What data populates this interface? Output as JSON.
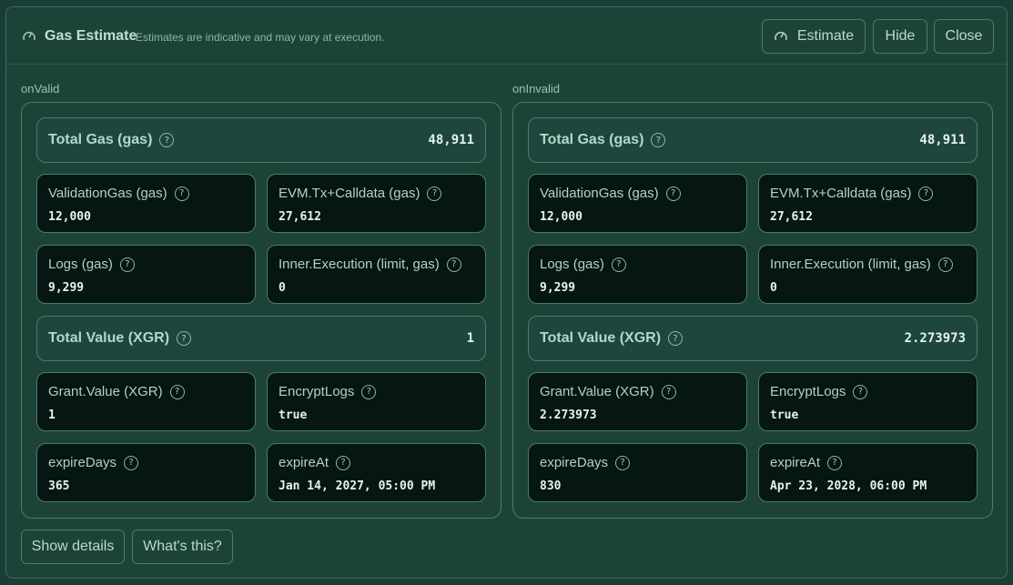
{
  "header": {
    "title": "Gas Estimate",
    "subtitle": "Estimates are indicative and may vary at execution.",
    "estimate_label": "Estimate",
    "hide_label": "Hide",
    "close_label": "Close"
  },
  "help_glyph": "?",
  "valid": {
    "label": "onValid",
    "total_gas": {
      "label": "Total Gas (gas)",
      "value": "48,911"
    },
    "validation_gas": {
      "label": "ValidationGas (gas)",
      "value": "12,000"
    },
    "evm_gas": {
      "label": "EVM.Tx+Calldata (gas)",
      "value": "27,612"
    },
    "logs_gas": {
      "label": "Logs (gas)",
      "value": "9,299"
    },
    "inner_exec": {
      "label": "Inner.Execution (limit, gas)",
      "value": "0"
    },
    "total_value": {
      "label": "Total Value (XGR)",
      "value": "1"
    },
    "grant_value": {
      "label": "Grant.Value (XGR)",
      "value": "1"
    },
    "encrypt_logs": {
      "label": "EncryptLogs",
      "value": "true"
    },
    "expire_days": {
      "label": "expireDays",
      "value": "365"
    },
    "expire_at": {
      "label": "expireAt",
      "value": "Jan 14, 2027, 05:00 PM"
    }
  },
  "invalid": {
    "label": "onInvalid",
    "total_gas": {
      "label": "Total Gas (gas)",
      "value": "48,911"
    },
    "validation_gas": {
      "label": "ValidationGas (gas)",
      "value": "12,000"
    },
    "evm_gas": {
      "label": "EVM.Tx+Calldata (gas)",
      "value": "27,612"
    },
    "logs_gas": {
      "label": "Logs (gas)",
      "value": "9,299"
    },
    "inner_exec": {
      "label": "Inner.Execution (limit, gas)",
      "value": "0"
    },
    "total_value": {
      "label": "Total Value (XGR)",
      "value": "2.273973"
    },
    "grant_value": {
      "label": "Grant.Value (XGR)",
      "value": "2.273973"
    },
    "encrypt_logs": {
      "label": "EncryptLogs",
      "value": "true"
    },
    "expire_days": {
      "label": "expireDays",
      "value": "830"
    },
    "expire_at": {
      "label": "expireAt",
      "value": "Apr 23, 2028, 06:00 PM"
    }
  },
  "footer": {
    "details_label": "Show details",
    "whats_label": "What's this?"
  },
  "icons": [
    "gauge-icon",
    "help-icon"
  ],
  "colors": {
    "background": "#1d4339",
    "card": "#051613",
    "border": "#4b7a6c",
    "text": "#c9e2d8"
  }
}
